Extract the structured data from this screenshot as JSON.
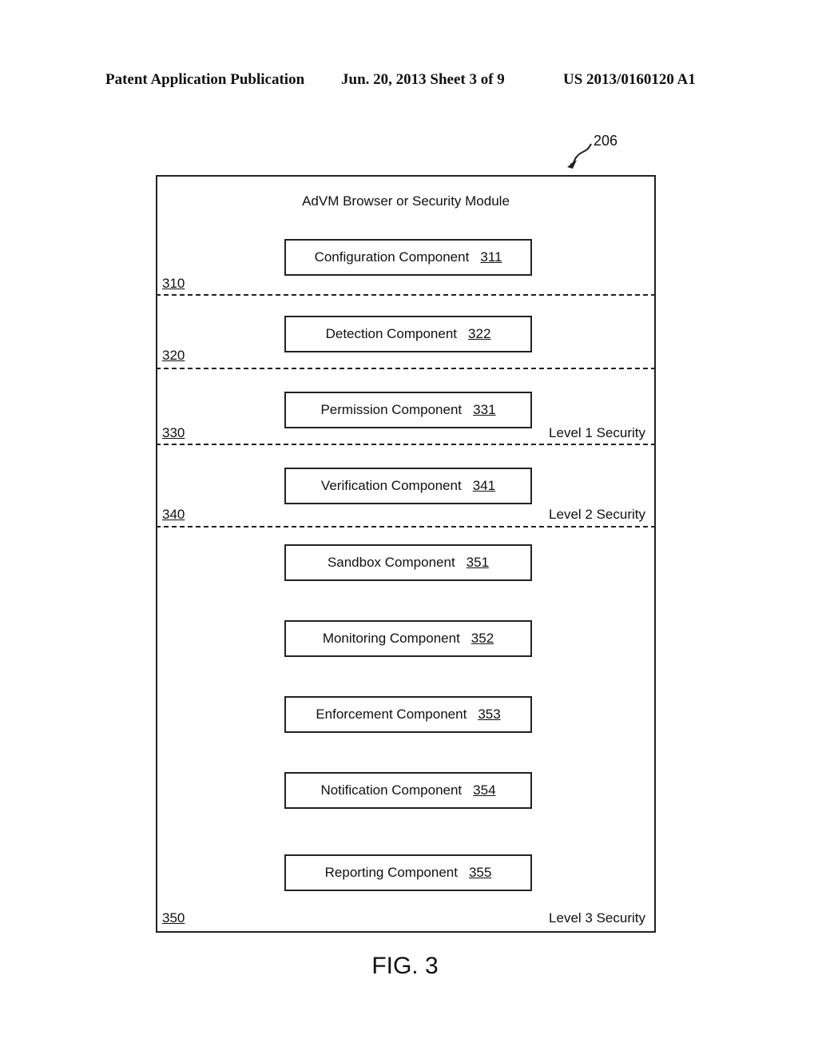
{
  "header": {
    "publication": "Patent Application Publication",
    "date_sheet": "Jun. 20, 2013  Sheet 3 of 9",
    "patent_number": "US 2013/0160120 A1"
  },
  "diagram": {
    "reference": "206",
    "title": "AdVM Browser or Security Module",
    "components": [
      {
        "label": "Configuration Component",
        "number": "311"
      },
      {
        "label": "Detection Component",
        "number": "322"
      },
      {
        "label": "Permission Component",
        "number": "331"
      },
      {
        "label": "Verification Component",
        "number": "341"
      },
      {
        "label": "Sandbox Component",
        "number": "351"
      },
      {
        "label": "Monitoring Component",
        "number": "352"
      },
      {
        "label": "Enforcement Component",
        "number": "353"
      },
      {
        "label": "Notification Component",
        "number": "354"
      },
      {
        "label": "Reporting Component",
        "number": "355"
      }
    ],
    "sections": [
      {
        "number": "310",
        "level": ""
      },
      {
        "number": "320",
        "level": ""
      },
      {
        "number": "330",
        "level": "Level 1 Security"
      },
      {
        "number": "340",
        "level": "Level 2 Security"
      },
      {
        "number": "350",
        "level": "Level 3 Security"
      }
    ]
  },
  "figure_label": "FIG. 3"
}
